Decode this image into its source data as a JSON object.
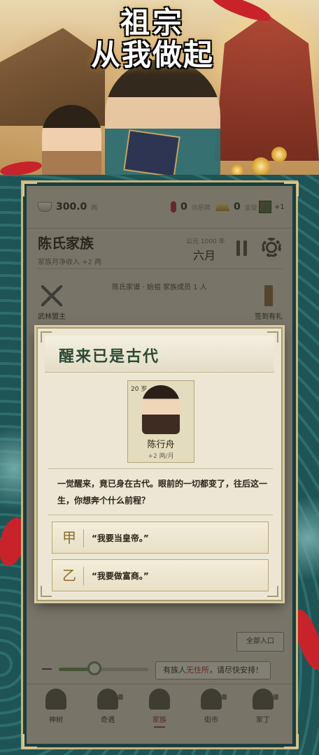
{
  "banner": {
    "title_line1": "祖宗",
    "title_line2": "从我做起"
  },
  "stats": {
    "silver_value": "300.0",
    "silver_unit": "两",
    "token_value": "0",
    "token_label": "许愿牌",
    "gold_value": "0",
    "gold_label": "金锭",
    "bonus_value": "+1"
  },
  "family": {
    "name": "陈氏家族",
    "monthly_income": "家族月净收入 +2 两",
    "era": "公元 1000 年",
    "month": "六月"
  },
  "lineage": "陈氏家谱 · 始祖    家族成员 1 人",
  "side_left_label": "武林盟主",
  "side_right_label": "签到有礼",
  "dialog": {
    "title": "醒来已是古代",
    "character": {
      "age": "20 岁",
      "name": "陈行舟",
      "income": "+2 两/月"
    },
    "story": "一觉醒来，竟已身在古代。眼前的一切都变了，往后这一生，你想奔个什么前程？",
    "choices": [
      {
        "mark": "甲",
        "text": "“我要当皇帝。”"
      },
      {
        "mark": "乙",
        "text": "“我要做富商。”"
      }
    ]
  },
  "enter_button": "全部入口",
  "notice": {
    "pre": "有族人",
    "highlight": "无住所",
    "post": "，请尽快安排！"
  },
  "speed_level": 0.4,
  "tabs": [
    {
      "label": "神树"
    },
    {
      "label": "奇遇"
    },
    {
      "label": "家族"
    },
    {
      "label": "街市"
    },
    {
      "label": "家丁"
    }
  ],
  "colors": {
    "accent_red": "#b12b2b",
    "frame_gold": "#c8b37a",
    "teal": "#1d4a4c"
  }
}
